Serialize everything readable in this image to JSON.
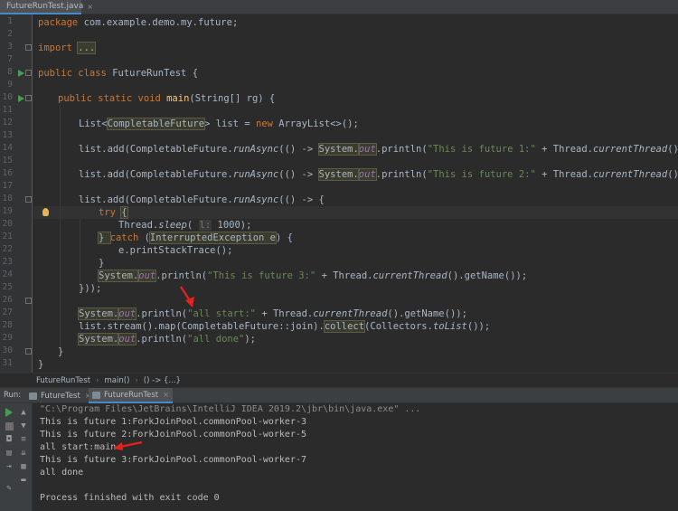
{
  "file_tab": {
    "label": "FutureRunTest.java",
    "close": "×"
  },
  "gutter": {
    "line_numbers": [
      "1",
      "2",
      "3",
      "7",
      "8",
      "9",
      "10",
      "11",
      "12",
      "13",
      "14",
      "15",
      "16",
      "17",
      "18",
      "19",
      "20",
      "21",
      "22",
      "23",
      "24",
      "25",
      "26",
      "27",
      "28",
      "29",
      "30",
      "31"
    ]
  },
  "code": {
    "l1": [
      "package ",
      "com.example.demo.my.future;"
    ],
    "l3": [
      "import ",
      "..."
    ],
    "l8": [
      "public class ",
      "FutureRunTest {"
    ],
    "l10": [
      "public static void ",
      "main",
      "(String[] rg) {"
    ],
    "l12": [
      "List<",
      "CompletableFuture",
      "> list = ",
      "new ",
      "ArrayList<>();"
    ],
    "l14": [
      "list.add(CompletableFuture.",
      "runAsync",
      "(() -> ",
      "System.",
      "out",
      ".println(",
      "\"This is future 1:\"",
      " + Thread.",
      "currentThread",
      "().getName()));"
    ],
    "l16": [
      "list.add(CompletableFuture.",
      "runAsync",
      "(() -> ",
      "System.",
      "out",
      ".println(",
      "\"This is future 2:\"",
      " + Thread.",
      "currentThread",
      "().getName()));"
    ],
    "l18": [
      "list.add(CompletableFuture.",
      "runAsync",
      "(() -> {"
    ],
    "l19": [
      "try ",
      "{"
    ],
    "l20": [
      "Thread.",
      "sleep",
      "( ",
      "l:",
      " 1000);"
    ],
    "l21": [
      "} ",
      "catch ",
      "(",
      "InterruptedException e",
      ") {"
    ],
    "l22": [
      "e.printStackTrace();"
    ],
    "l23": [
      "}"
    ],
    "l24": [
      "System.",
      "out",
      ".println(",
      "\"This is future 3:\"",
      " + Thread.",
      "currentThread",
      "().getName());"
    ],
    "l25": [
      "}));"
    ],
    "l27": [
      "System.",
      "out",
      ".println(",
      "\"all start:\"",
      " + Thread.",
      "currentThread",
      "().getName());"
    ],
    "l28": [
      "list.stream().map(CompletableFuture::join).",
      "collect",
      "(Collectors.",
      "toList",
      "());"
    ],
    "l29": [
      "System.",
      "out",
      ".println(",
      "\"all done\"",
      ");"
    ],
    "l30": [
      "}"
    ],
    "l31": [
      "}"
    ]
  },
  "breadcrumb": {
    "items": [
      "FutureRunTest",
      "main()",
      "() -> {...}"
    ],
    "sep": "›"
  },
  "run_panel": {
    "label": "Run:",
    "tabs": [
      {
        "label": "FutureTest",
        "close": "×"
      },
      {
        "label": "FutureRunTest",
        "close": "×"
      }
    ]
  },
  "console": {
    "lines": [
      "\"C:\\Program Files\\JetBrains\\IntelliJ IDEA 2019.2\\jbr\\bin\\java.exe\" ...",
      "This is future 1:ForkJoinPool.commonPool-worker-3",
      "This is future 2:ForkJoinPool.commonPool-worker-5",
      "all start:main",
      "This is future 3:ForkJoinPool.commonPool-worker-7",
      "all done",
      "",
      "Process finished with exit code 0"
    ]
  },
  "colors": {
    "accent": "#4a88c7",
    "annotation_arrow": "#e8201e",
    "run_green": "#499c54"
  },
  "icons": [
    "java-file-icon",
    "run-gutter-icon",
    "intention-bulb-icon",
    "rerun-icon",
    "stop-icon",
    "scroll-up-icon",
    "scroll-down-icon",
    "camera-icon",
    "pin-icon",
    "print-icon",
    "trash-icon"
  ]
}
